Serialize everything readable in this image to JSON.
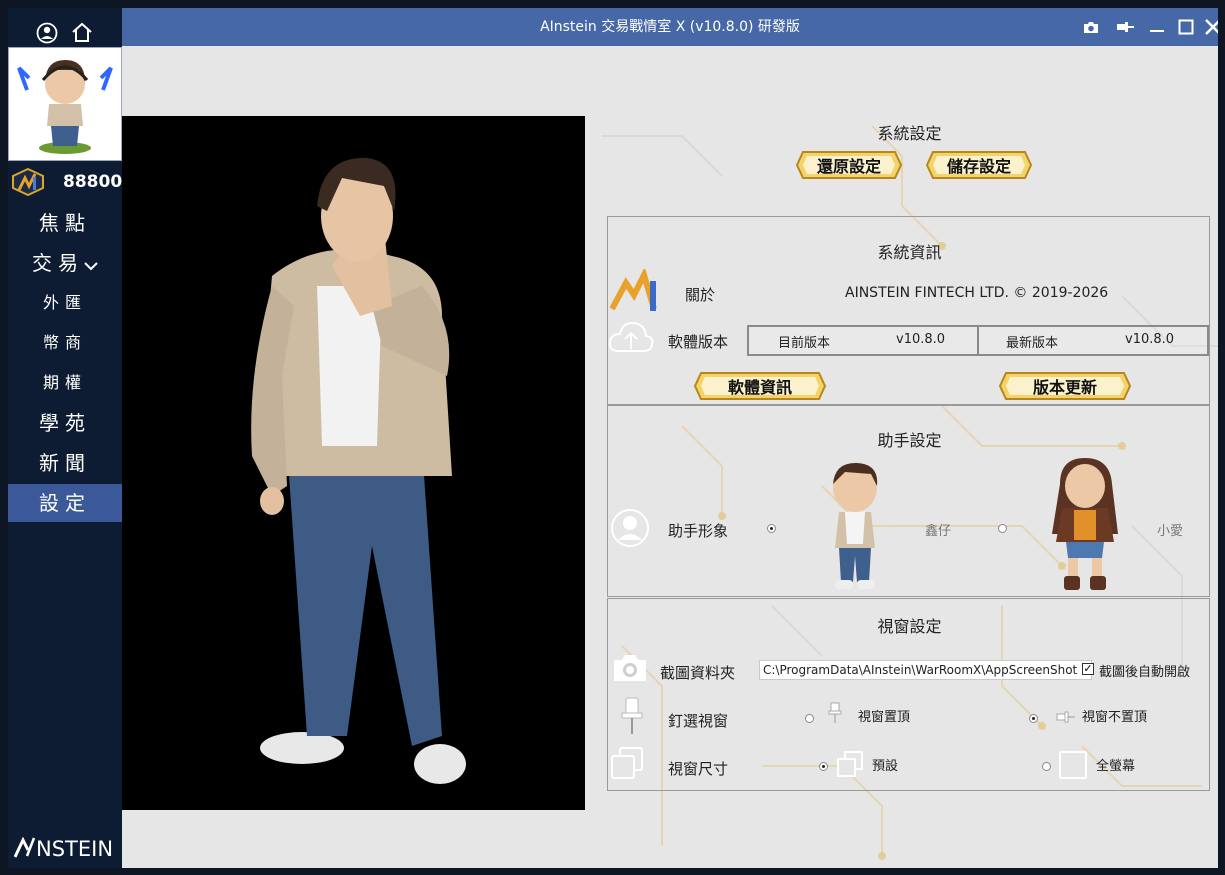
{
  "window": {
    "title": "AInstein 交易戰情室 X (v10.8.0) 研發版"
  },
  "sidebar": {
    "points": "88800",
    "items": [
      {
        "label": "焦點"
      },
      {
        "label": "交易"
      },
      {
        "label": "外匯"
      },
      {
        "label": "幣商"
      },
      {
        "label": "期權"
      },
      {
        "label": "學苑"
      },
      {
        "label": "新聞"
      },
      {
        "label": "設定"
      }
    ],
    "logo_text": "NSTEIN"
  },
  "system_settings": {
    "title": "系統設定",
    "restore_label": "還原設定",
    "save_label": "儲存設定"
  },
  "system_info": {
    "title": "系統資訊",
    "about_label": "關於",
    "copyright": "AINSTEIN FINTECH LTD. © 2019-2026",
    "software_version_label": "軟體版本",
    "current_version_label": "目前版本",
    "current_version": "v10.8.0",
    "latest_version_label": "最新版本",
    "latest_version": "v10.8.0",
    "software_info_button": "軟體資訊",
    "update_button": "版本更新"
  },
  "assistant_settings": {
    "title": "助手設定",
    "avatar_label": "助手形象",
    "option_male": "鑫仔",
    "option_female": "小愛"
  },
  "window_settings": {
    "title": "視窗設定",
    "screenshot_folder_label": "截圖資料夾",
    "screenshot_path": "C:\\ProgramData\\AInstein\\WarRoomX\\AppScreenShot",
    "auto_open_label": "截圖後自動開啟",
    "pin_window_label": "釘選視窗",
    "pin_top_label": "視窗置頂",
    "pin_none_label": "視窗不置頂",
    "window_size_label": "視窗尺寸",
    "size_default_label": "預設",
    "size_fullscreen_label": "全螢幕"
  },
  "colors": {
    "titlebar": "#4668a6",
    "sidebar": "#0e1c33",
    "nav_active": "#3b5899",
    "gold": "#e0b030"
  }
}
